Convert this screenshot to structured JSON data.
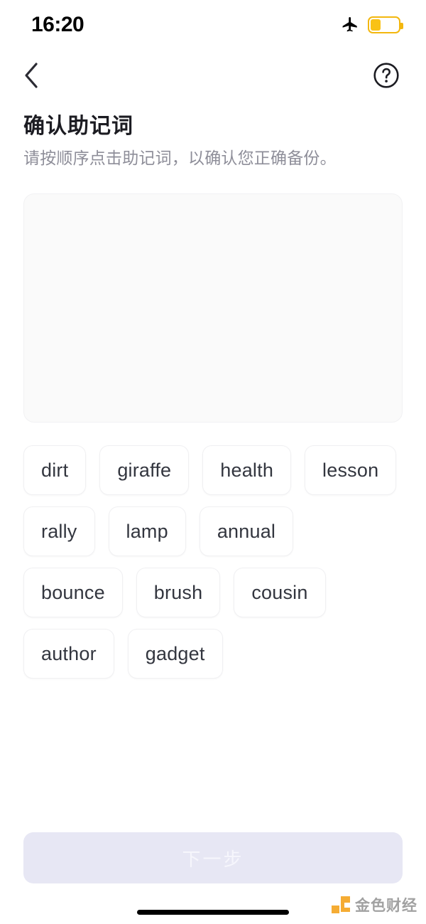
{
  "status_bar": {
    "time": "16:20",
    "airplane_icon": "airplane-mode-icon",
    "battery_icon": "battery-low-power-icon",
    "battery_level_percent": 36,
    "battery_color": "#f9c216"
  },
  "nav": {
    "back_icon": "chevron-left-icon",
    "help_icon": "question-mark-circle-icon"
  },
  "header": {
    "title": "确认助记词",
    "subtitle": "请按顺序点击助记词，以确认您正确备份。"
  },
  "answer_area": {
    "selected_words": [],
    "background_color": "#fafafa"
  },
  "word_pool": {
    "words": [
      "dirt",
      "giraffe",
      "health",
      "lesson",
      "rally",
      "lamp",
      "annual",
      "bounce",
      "brush",
      "cousin",
      "author",
      "gadget"
    ]
  },
  "footer": {
    "next_label": "下一步",
    "next_disabled": true,
    "next_background_color": "#e7e7f4",
    "next_text_color": "#f6f6fc"
  },
  "watermark": {
    "text": "金色财经",
    "logo_color": "#f5a623"
  }
}
